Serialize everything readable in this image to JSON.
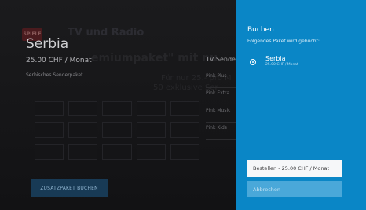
{
  "background": {
    "logo_label": "SPIELE",
    "headline": "TV und Radio",
    "ghost_line1": "emiumpaket\" mit nu",
    "ghost_line2": "Für nur 25.- pro M",
    "ghost_line3": "50 exklusive Ser",
    "package": {
      "title": "Serbia",
      "price": "25.00 CHF / Monat",
      "description": "Serbisches Senderpaket"
    },
    "channels": {
      "header": "TV Sende",
      "items": [
        "Pink Plus",
        "Pink Extra",
        "Pink Music",
        "Pink Kids"
      ]
    },
    "addon_button": "ZUSATZPAKET BUCHEN"
  },
  "panel": {
    "title": "Buchen",
    "subtitle": "Folgendes Paket wird gebucht:",
    "option": {
      "name": "Serbia",
      "price": "25.00 CHF / Monat",
      "selected": true
    },
    "order_button": "Bestellen - 25.00 CHF / Monat",
    "cancel_button": "Abbrechen"
  },
  "colors": {
    "panel_bg": "#0a86c6",
    "addon_btn_bg": "#183a55",
    "order_btn_bg": "#f6f7f9",
    "cancel_btn_bg": "#4aa8d9"
  }
}
